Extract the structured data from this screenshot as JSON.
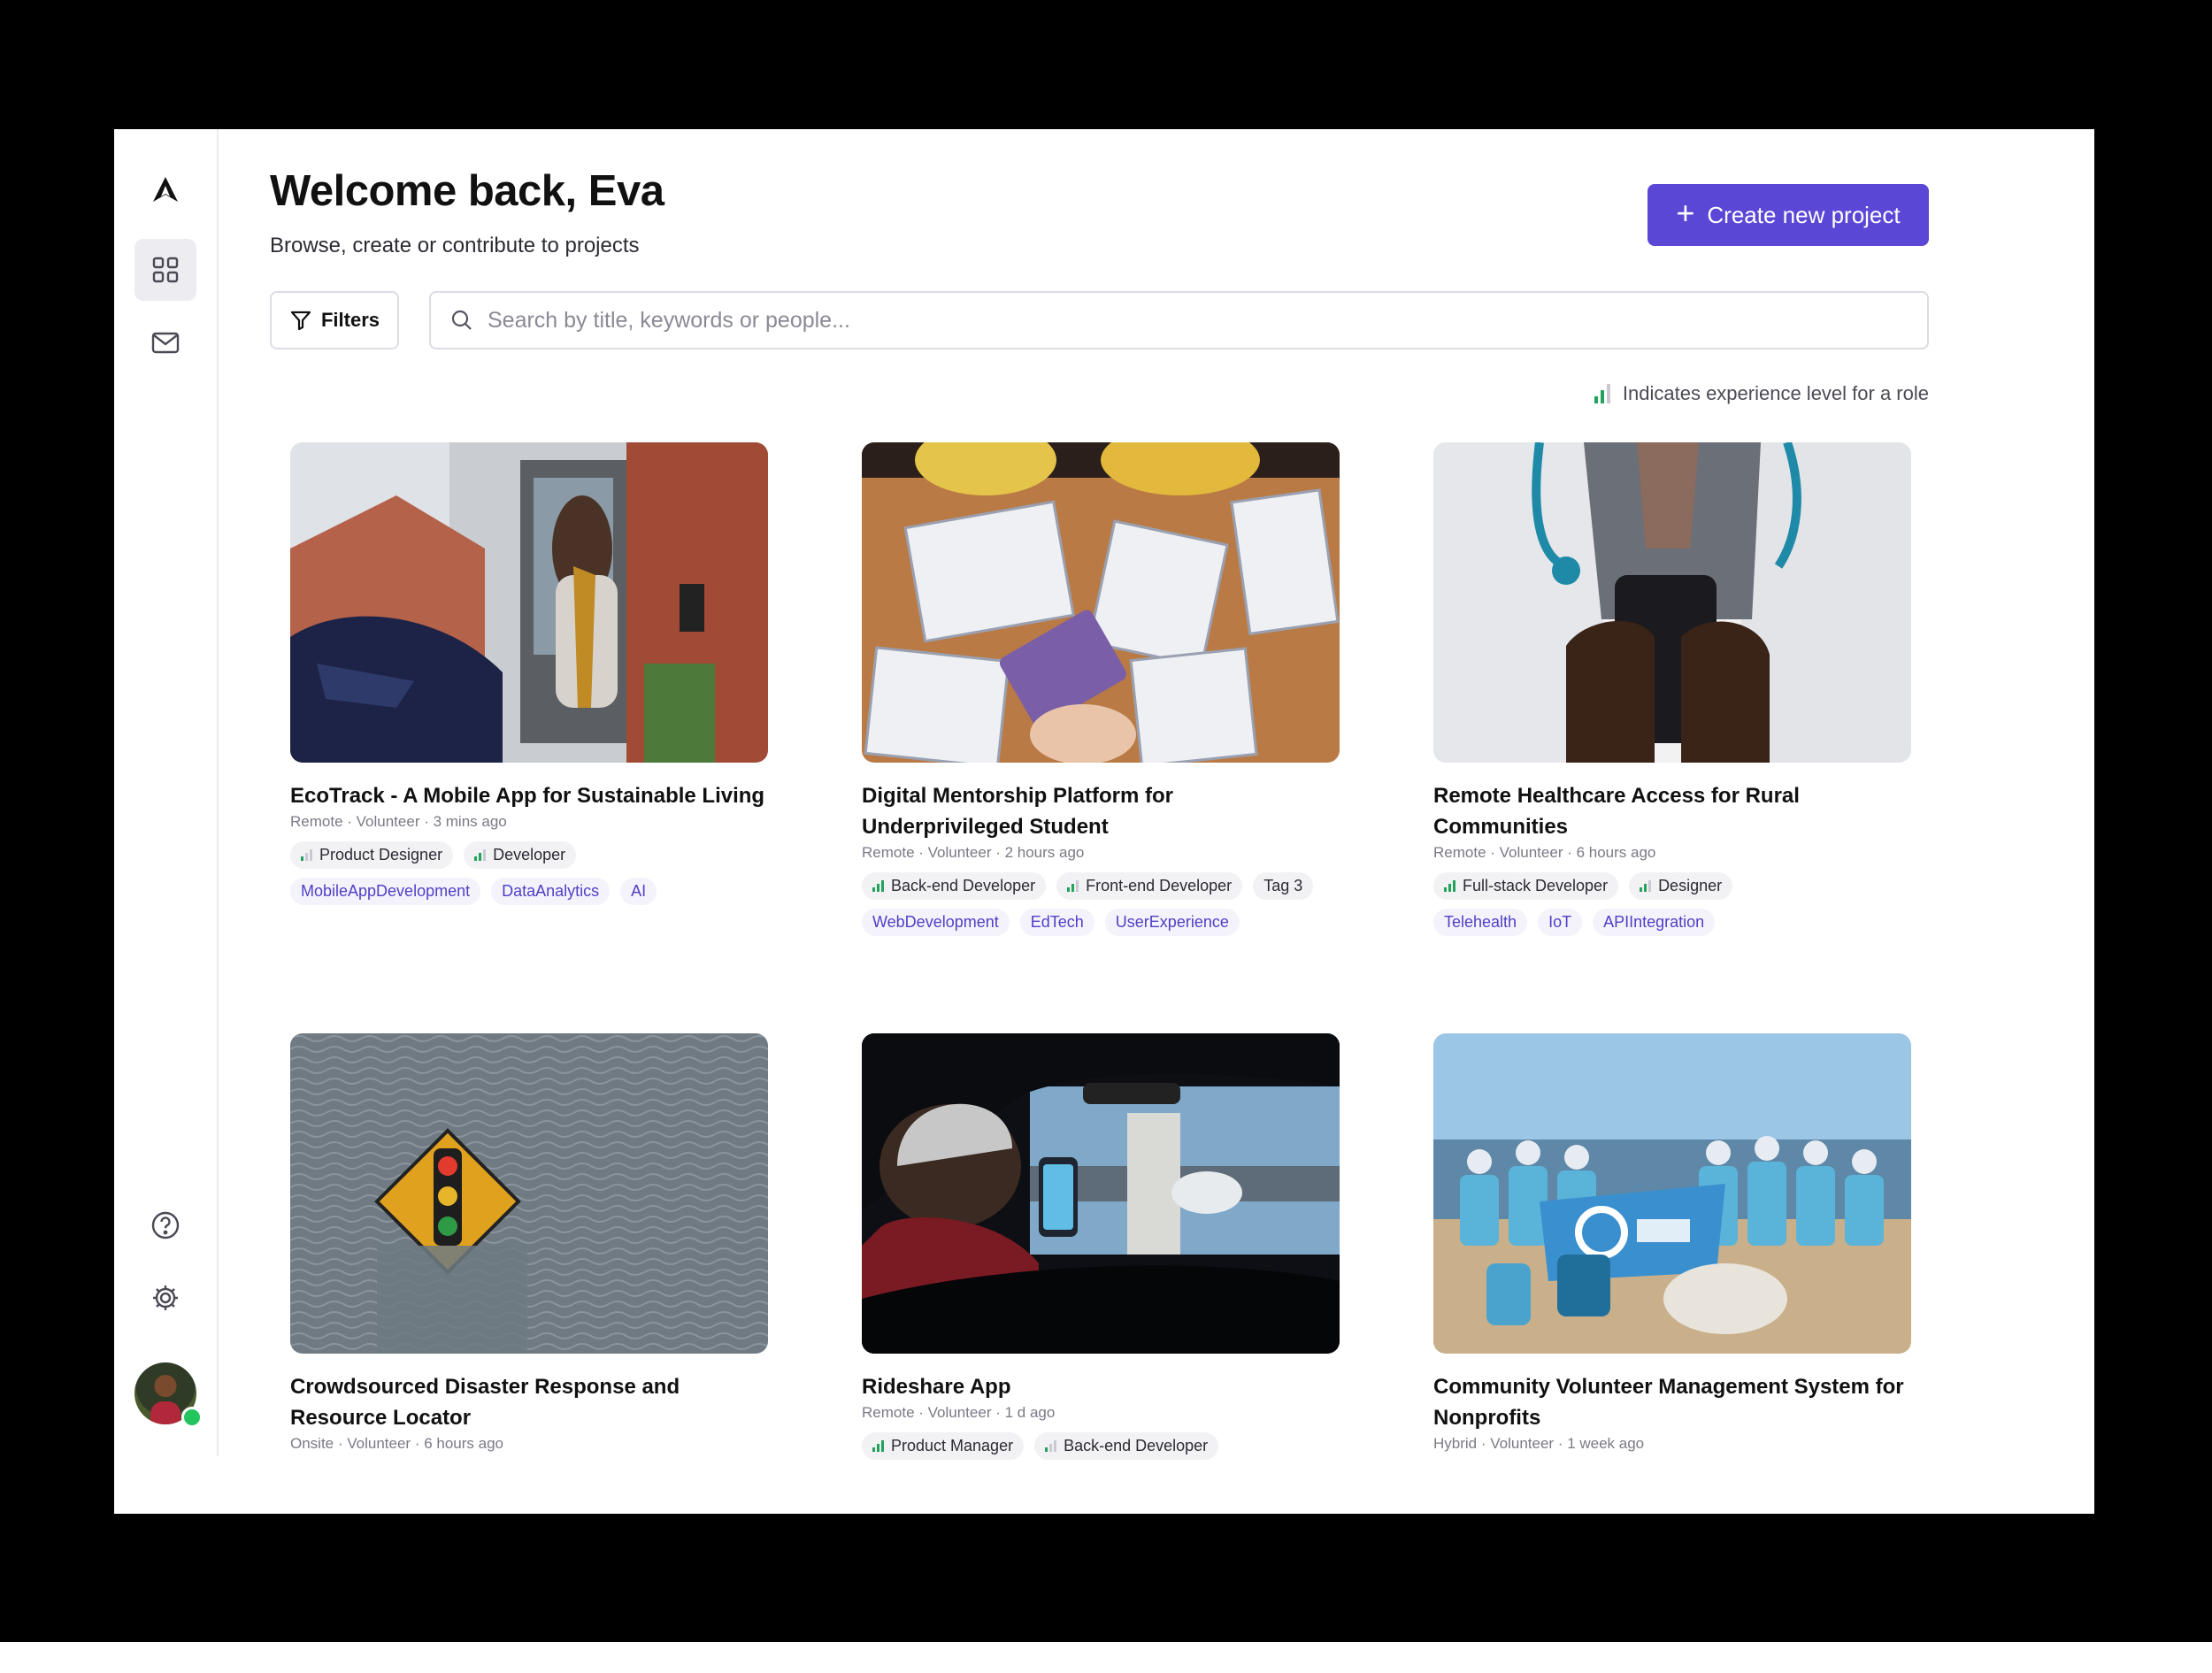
{
  "user": {
    "name": "Eva",
    "status": "online"
  },
  "header": {
    "title": "Welcome back, Eva",
    "subtitle": "Browse, create or contribute to projects",
    "create_label": "Create new project"
  },
  "toolbar": {
    "filters_label": "Filters",
    "search_placeholder": "Search by title, keywords or people..."
  },
  "legend": {
    "text": "Indicates experience level for a role"
  },
  "colors": {
    "accent": "#5b47d6",
    "level": "#22a25a",
    "tag_text": "#4f3fc7",
    "online": "#22c55e"
  },
  "sidebar": {
    "items": [
      {
        "name": "logo",
        "icon": "logo-icon"
      },
      {
        "name": "dashboard",
        "icon": "grid-icon",
        "active": true
      },
      {
        "name": "messages",
        "icon": "mail-icon"
      },
      {
        "name": "help",
        "icon": "help-icon"
      },
      {
        "name": "settings",
        "icon": "gear-icon"
      }
    ]
  },
  "projects": [
    {
      "title": "EcoTrack - A Mobile App for Sustainable Living",
      "location": "Remote",
      "type": "Volunteer",
      "time": "3 mins ago",
      "roles": [
        {
          "name": "Product Designer",
          "level": 1
        },
        {
          "name": "Developer",
          "level": 2
        }
      ],
      "tags": [
        "MobileAppDevelopment",
        "DataAnalytics",
        "AI"
      ],
      "image": "photo-ev-charging"
    },
    {
      "title": "Digital Mentorship Platform for Underprivileged Student",
      "location": "Remote",
      "type": "Volunteer",
      "time": "2 hours ago",
      "roles": [
        {
          "name": "Back-end Developer",
          "level": 3
        },
        {
          "name": "Front-end Developer",
          "level": 2
        },
        {
          "name": "Tag 3",
          "level": 0
        }
      ],
      "tags": [
        "WebDevelopment",
        "EdTech",
        "UserExperience"
      ],
      "image": "photo-kids-learning"
    },
    {
      "title": "Remote Healthcare Access for Rural Communities",
      "location": "Remote",
      "type": "Volunteer",
      "time": "6 hours ago",
      "roles": [
        {
          "name": "Full-stack Developer",
          "level": 3
        },
        {
          "name": "Designer",
          "level": 2
        }
      ],
      "tags": [
        "Telehealth",
        "IoT",
        "APIIntegration"
      ],
      "image": "photo-doctor-phone"
    },
    {
      "title": "Crowdsourced Disaster Response and Resource Locator",
      "location": "Onsite",
      "type": "Volunteer",
      "time": "6 hours ago",
      "roles": [],
      "tags": [],
      "image": "photo-flooded-sign"
    },
    {
      "title": "Rideshare App",
      "location": "Remote",
      "type": "Volunteer",
      "time": "1 d ago",
      "roles": [
        {
          "name": "Product Manager",
          "level": 3
        },
        {
          "name": "Back-end Developer",
          "level": 1
        }
      ],
      "tags": [],
      "image": "photo-car-driver"
    },
    {
      "title": "Community Volunteer Management System for Nonprofits",
      "location": "Hybrid",
      "type": "Volunteer",
      "time": "1 week ago",
      "roles": [],
      "tags": [],
      "image": "photo-beach-cleanup"
    }
  ]
}
